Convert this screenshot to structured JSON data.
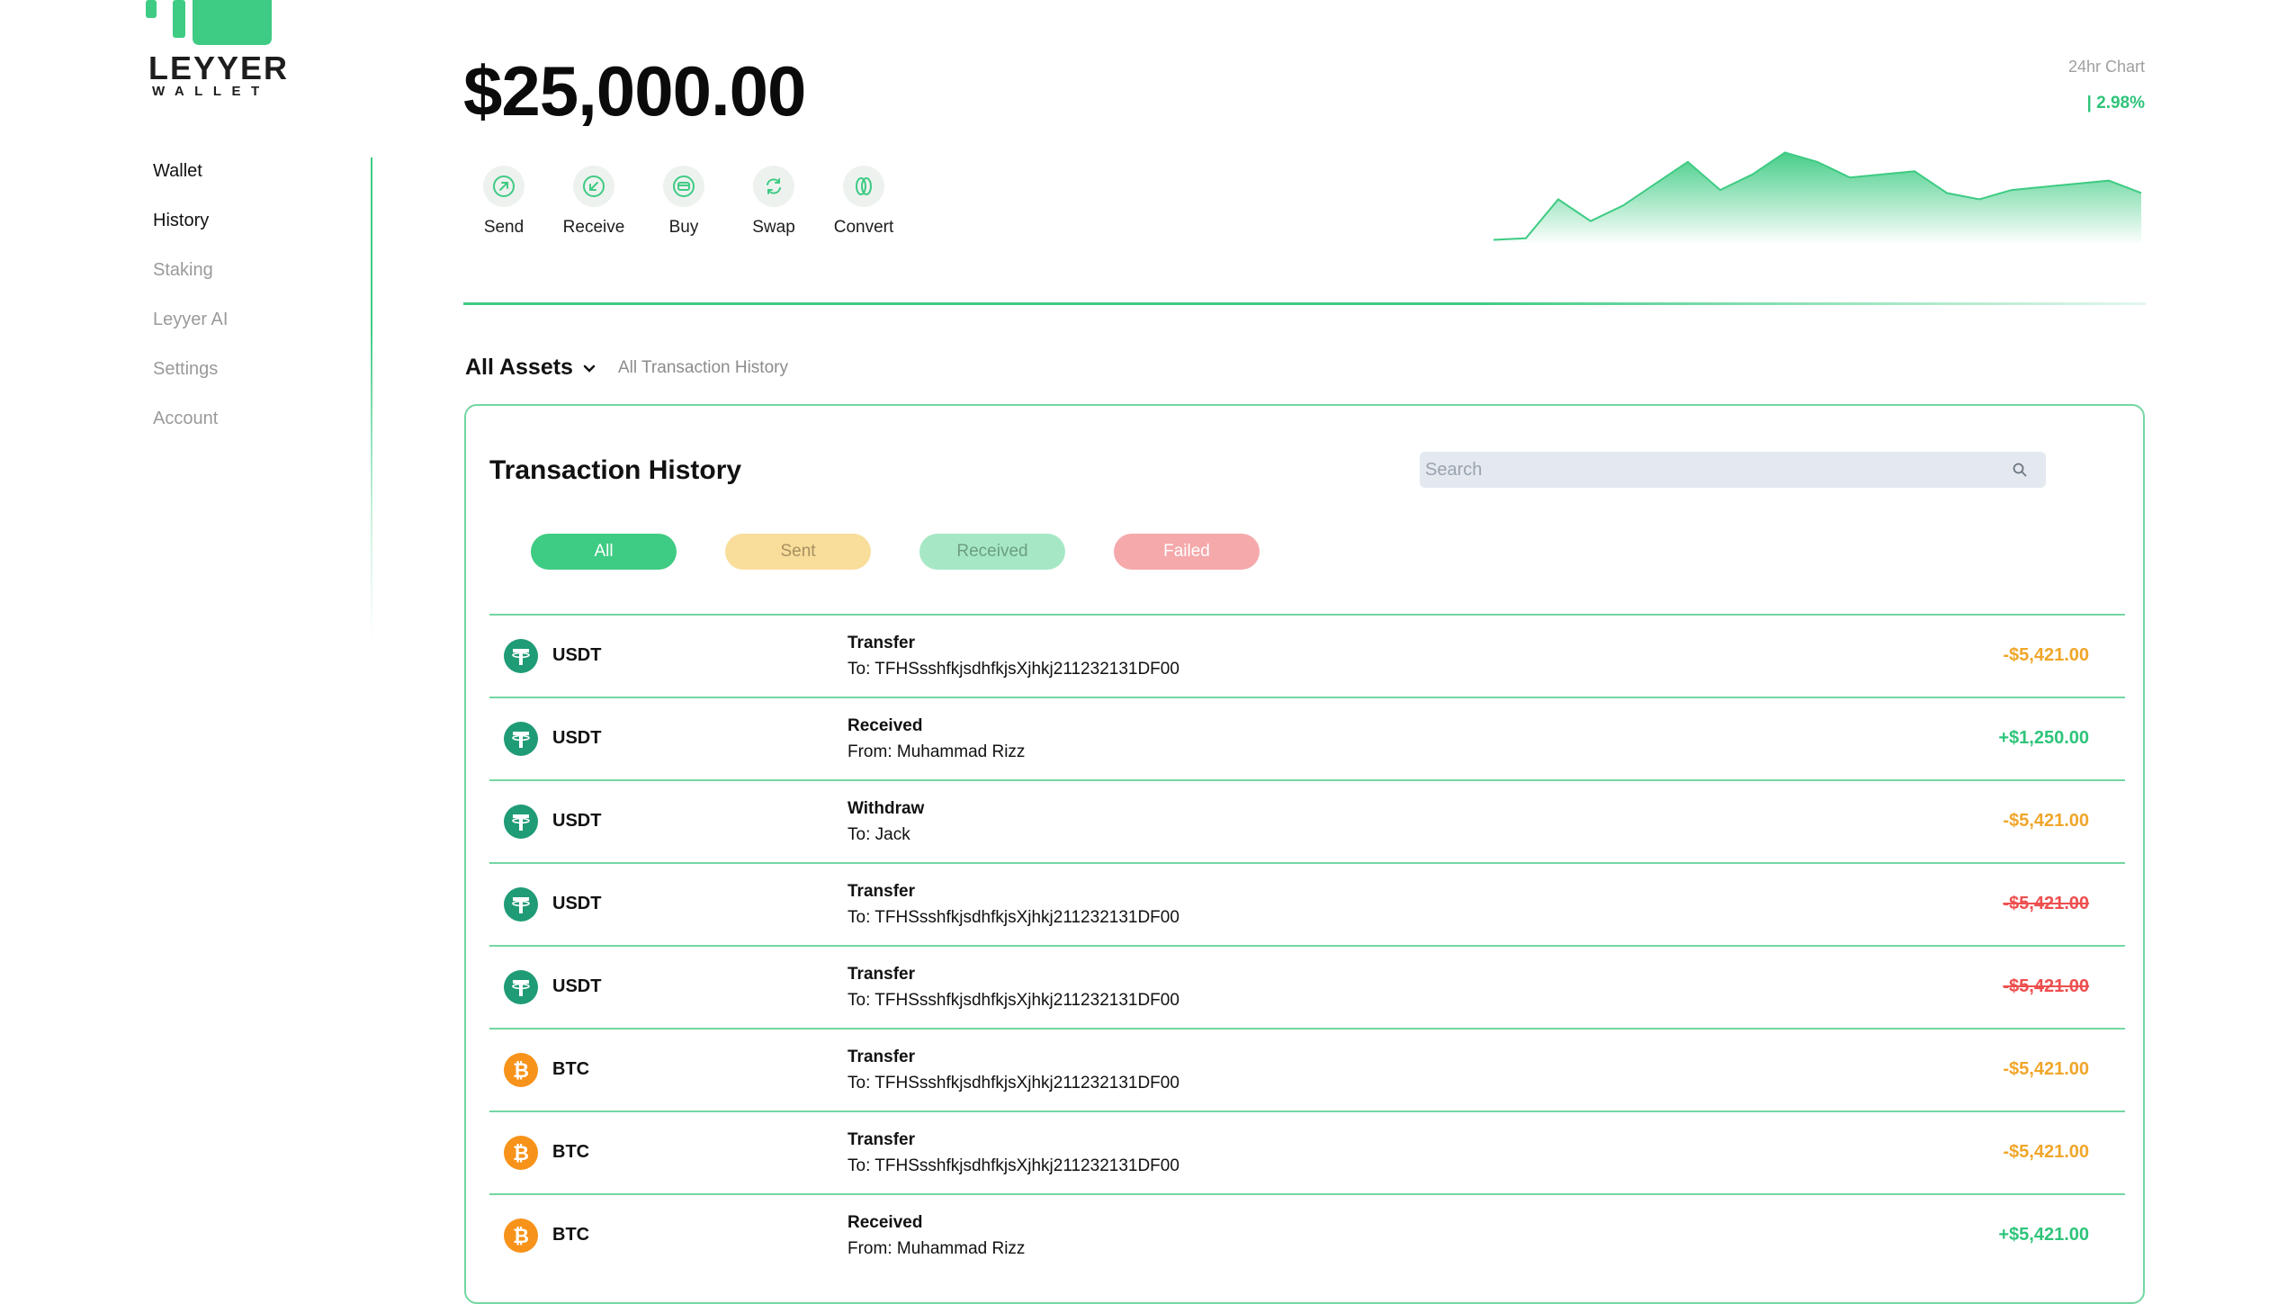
{
  "brand": {
    "name": "LEYYER",
    "sub": "WALLET",
    "accent": "#3ecb83"
  },
  "sidebar": {
    "items": [
      {
        "label": "Wallet",
        "active": true
      },
      {
        "label": "History",
        "active": true
      },
      {
        "label": "Staking",
        "active": false
      },
      {
        "label": "Leyyer AI",
        "active": false
      },
      {
        "label": "Settings",
        "active": false
      },
      {
        "label": "Account",
        "active": false
      }
    ]
  },
  "balance": "$25,000.00",
  "actions": [
    {
      "label": "Send",
      "icon": "arrow-up-right-icon"
    },
    {
      "label": "Receive",
      "icon": "arrow-down-left-icon"
    },
    {
      "label": "Buy",
      "icon": "card-icon"
    },
    {
      "label": "Swap",
      "icon": "swap-icon"
    },
    {
      "label": "Convert",
      "icon": "coins-icon"
    }
  ],
  "chart": {
    "title": "24hr Chart",
    "change": "| 2.98%"
  },
  "chart_data": {
    "type": "area",
    "title": "24hr Chart",
    "xlabel": "",
    "ylabel": "",
    "values": [
      2,
      3,
      28,
      14,
      24,
      38,
      52,
      34,
      44,
      58,
      52,
      42,
      44,
      46,
      32,
      28,
      34,
      36,
      38,
      40,
      32
    ],
    "ylim": [
      0,
      60
    ],
    "color": "#3ecb83",
    "grid": false
  },
  "assets": {
    "label": "All Assets",
    "sub": "All Transaction History"
  },
  "history": {
    "title": "Transaction History",
    "search_placeholder": "Search",
    "filters": {
      "all": "All",
      "sent": "Sent",
      "received": "Received",
      "failed": "Failed"
    },
    "rows": [
      {
        "coin": "USDT",
        "type": "Transfer",
        "detail": "To: TFHSsshfkjsdhfkjsXjhkj211232131DF00",
        "amount": "-$5,421.00",
        "status": "sent"
      },
      {
        "coin": "USDT",
        "type": "Received",
        "detail": "From: Muhammad Rizz",
        "amount": "+$1,250.00",
        "status": "received"
      },
      {
        "coin": "USDT",
        "type": "Withdraw",
        "detail": "To: Jack",
        "amount": "-$5,421.00",
        "status": "sent"
      },
      {
        "coin": "USDT",
        "type": "Transfer",
        "detail": "To: TFHSsshfkjsdhfkjsXjhkj211232131DF00",
        "amount": "-$5,421.00",
        "status": "failed"
      },
      {
        "coin": "USDT",
        "type": "Transfer",
        "detail": "To: TFHSsshfkjsdhfkjsXjhkj211232131DF00",
        "amount": "-$5,421.00",
        "status": "failed"
      },
      {
        "coin": "BTC",
        "type": "Transfer",
        "detail": "To: TFHSsshfkjsdhfkjsXjhkj211232131DF00",
        "amount": "-$5,421.00",
        "status": "sent"
      },
      {
        "coin": "BTC",
        "type": "Transfer",
        "detail": "To: TFHSsshfkjsdhfkjsXjhkj211232131DF00",
        "amount": "-$5,421.00",
        "status": "sent"
      },
      {
        "coin": "BTC",
        "type": "Received",
        "detail": "From: Muhammad Rizz",
        "amount": "+$5,421.00",
        "status": "received"
      }
    ]
  }
}
